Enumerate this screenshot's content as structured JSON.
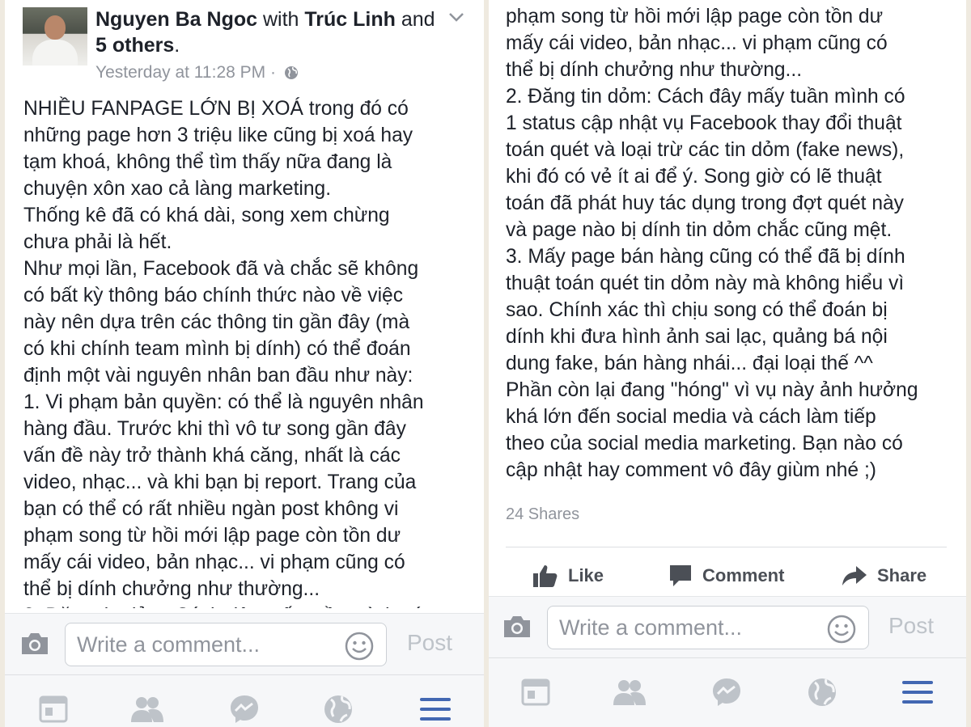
{
  "post": {
    "author": "Nguyen Ba Ngoc",
    "with_word": "with",
    "tagged": "Trúc Linh",
    "and_word": "and",
    "others": "5 others",
    "period": ".",
    "timestamp": "Yesterday at 11:28 PM",
    "separator": "·",
    "privacy_icon": "globe-icon",
    "body_left": "NHIỀU FANPAGE LỚN BỊ XOÁ trong đó có\nnhững page hơn 3 triệu like cũng bị xoá hay\ntạm khoá, không thể tìm thấy nữa đang là\nchuyện xôn xao cả làng marketing.\nThống kê đã có khá dài, song xem chừng\nchưa phải là hết.\nNhư mọi lần, Facebook đã và chắc sẽ không\ncó bất kỳ thông báo chính thức nào về việc\nnày nên dựa trên các thông tin gần đây (mà\ncó khi chính team mình bị dính) có thể đoán\nđịnh một vài nguyên nhân ban đầu như này:\n1. Vi phạm bản quyền: có thể là nguyên nhân\nhàng đầu. Trước khi thì vô tư song gần đây\nvấn đề này trở thành khá căng, nhất là các\nvideo, nhạc... và khi bạn bị report. Trang của\nbạn có thể có rất nhiều ngàn post không vi\nphạm song từ hồi mới lập page còn tồn dư\nmấy cái video, bản nhạc... vi phạm cũng có\nthể bị dính chưởng như thường...\n2. Đăng tin dỏm: Cách đây mấy tuần mình có",
    "body_right": "phạm song từ hồi mới lập page còn tồn dư\nmấy cái video, bản nhạc... vi phạm cũng có\nthể bị dính chưởng như thường...\n2. Đăng tin dỏm: Cách đây mấy tuần mình có\n1 status cập nhật vụ Facebook thay đổi thuật\ntoán quét và loại trừ các tin dỏm (fake news),\nkhi đó có vẻ ít ai để ý. Song giờ có lẽ thuật\ntoán đã phát huy tác dụng trong đợt quét này\nvà page nào bị dính tin dỏm chắc cũng mệt.\n3. Mấy page bán hàng cũng có thể đã bị dính\nthuật toán quét tin dỏm này mà không hiểu vì\nsao. Chính xác thì chịu song có thể đoán bị\ndính khi đưa hình ảnh sai lạc, quảng bá nội\ndung fake, bán hàng nhái... đại loại thế ^^\nPhần còn lại đang \"hóng\" vì vụ này ảnh hưởng\nkhá lớn đến social media và cách làm tiếp\ntheo của social media marketing. Bạn nào có\ncập nhật hay comment vô đây giùm nhé ;)",
    "shares": "24 Shares"
  },
  "actions": {
    "like": "Like",
    "comment": "Comment",
    "share": "Share"
  },
  "composer": {
    "placeholder": "Write a comment...",
    "post_label": "Post"
  },
  "nav": {
    "icons": [
      "news-feed-icon",
      "friends-icon",
      "messenger-icon",
      "globe-notifications-icon",
      "menu-icon"
    ],
    "active_color": "#4267b2",
    "inactive_color": "#bec3c9"
  }
}
